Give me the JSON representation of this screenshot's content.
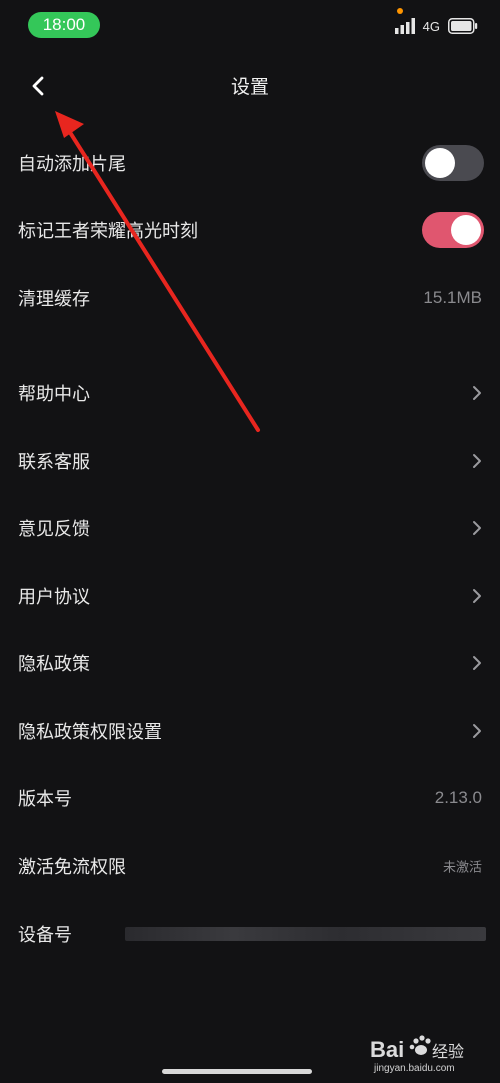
{
  "status_bar": {
    "time": "18:00",
    "network": "4G",
    "time_pill_color": "#34c759"
  },
  "header": {
    "title": "设置",
    "back_icon": "chevron-left-icon"
  },
  "settings": {
    "auto_add_ending": {
      "label": "自动添加片尾",
      "enabled": false
    },
    "mark_highlights": {
      "label": "标记王者荣耀高光时刻",
      "enabled": true,
      "accent_color": "#e0566f"
    },
    "clear_cache": {
      "label": "清理缓存",
      "value": "15.1MB"
    },
    "help_center": {
      "label": "帮助中心"
    },
    "contact_support": {
      "label": "联系客服"
    },
    "feedback": {
      "label": "意见反馈"
    },
    "user_agreement": {
      "label": "用户协议"
    },
    "privacy_policy": {
      "label": "隐私政策"
    },
    "privacy_permissions": {
      "label": "隐私政策权限设置"
    },
    "version": {
      "label": "版本号",
      "value": "2.13.0"
    },
    "free_data": {
      "label": "激活免流权限",
      "value": "未激活"
    },
    "device_id": {
      "label": "设备号"
    }
  },
  "annotation": {
    "arrow_color": "#e8261f"
  },
  "watermark": {
    "brand": "Bai",
    "brand_suffix": "经验",
    "url": "jingyan.baidu.com"
  }
}
